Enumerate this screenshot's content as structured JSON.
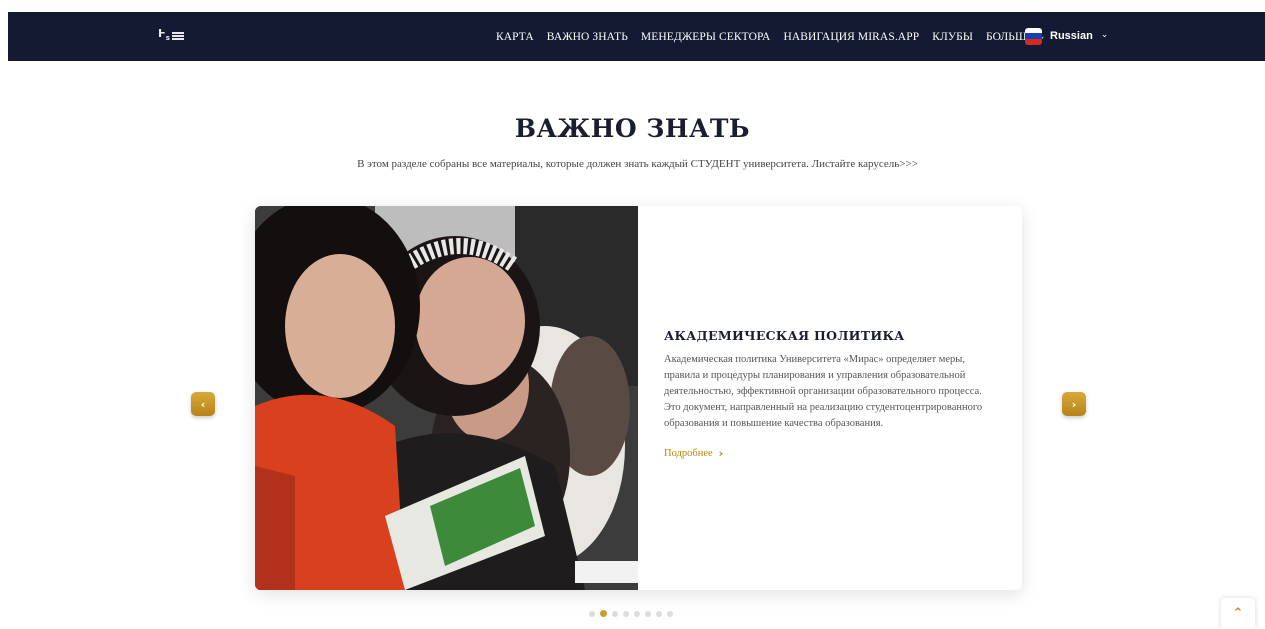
{
  "nav": {
    "items": [
      {
        "label": "КАРТА"
      },
      {
        "label": "ВАЖНО ЗНАТЬ"
      },
      {
        "label": "МЕНЕДЖЕРЫ СЕКТОРА"
      },
      {
        "label": "НАВИГАЦИЯ MIRAS.APP"
      },
      {
        "label": "КЛУБЫ"
      },
      {
        "label": "БОЛЬШЕ"
      }
    ],
    "language": "Russian"
  },
  "section": {
    "title": "ВАЖНО ЗНАТЬ",
    "subtitle": "В этом разделе собраны все материалы, которые должен знать каждый СТУДЕНТ университета. Листайте карусель>>>"
  },
  "slide": {
    "title": "АКАДЕМИЧЕСКАЯ ПОЛИТИКА",
    "text": "Академическая политика Университета «Мирас» определяет меры, правила и процедуры планирования и управления образовательной деятельностью, эффективной организации образовательного процесса. Это документ, направленный на реализацию студентоцентрированного образования и повышение качества образования.",
    "more_label": "Подробнее"
  },
  "carousel": {
    "total_slides": 8,
    "active_index": 1
  },
  "colors": {
    "navbar": "#141a31",
    "accent": "#d19a2a"
  },
  "icons": {
    "prev": "chevron-left-icon",
    "next": "chevron-right-icon",
    "scroll_top": "chevron-up-icon",
    "dropdown": "chevron-down-icon",
    "flag": "russia-flag-icon"
  }
}
